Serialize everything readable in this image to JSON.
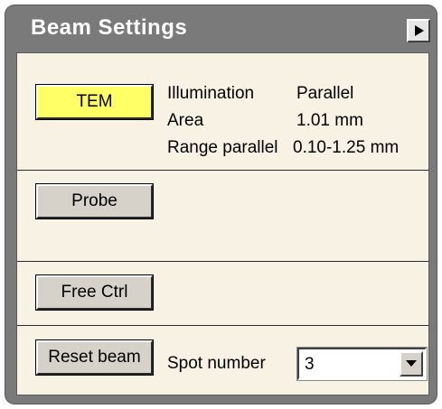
{
  "window": {
    "title": "Beam Settings"
  },
  "mode_section": {
    "tem_button": "TEM",
    "rows": [
      {
        "label": "Illumination",
        "value": "Parallel"
      },
      {
        "label": "Area",
        "value": "1.01 mm"
      },
      {
        "label": "Range parallel",
        "value": "0.10-1.25 mm"
      }
    ]
  },
  "probe_button": "Probe",
  "free_ctrl_button": "Free Ctrl",
  "reset_beam_button": "Reset beam",
  "spot_number": {
    "label": "Spot number",
    "value": "3"
  },
  "icons": {
    "title_button": "play-right-icon",
    "dropdown": "chevron-down-icon"
  },
  "colors": {
    "active_mode": "#ffff66",
    "panel_bg": "#f8f2e4",
    "title_bar": "#7a7a7a"
  }
}
